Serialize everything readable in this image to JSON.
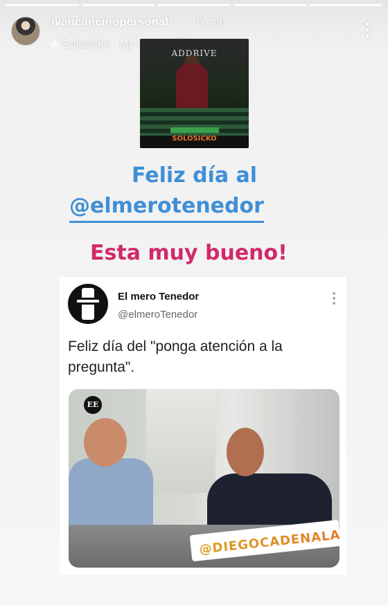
{
  "story": {
    "username": "ivancancinopersonal",
    "time": "6 min",
    "music": "Solosicko · My Lawyer 🅴",
    "progress_segments": 5
  },
  "album": {
    "title": "ADDRIVE",
    "artist": "SOLOSICKO"
  },
  "caption": {
    "line1": "Feliz día al",
    "line2": "@elmerotenedor",
    "line3": "Esta muy bueno!"
  },
  "tweet": {
    "name": "El mero Tenedor",
    "handle": "@elmeroTenedor",
    "text": "Feliz día del \"ponga atención a la pregunta\".",
    "photo_badge": "EE",
    "sticker": "@DIEGOCADENALAW"
  },
  "colors": {
    "caption_blue": "#3f8fd6",
    "caption_pink": "#d12a6a"
  }
}
